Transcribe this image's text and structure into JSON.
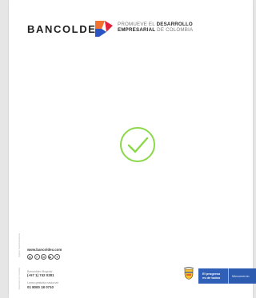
{
  "header": {
    "brand": "BANCOLDEX",
    "tagline_line1_prefix": "PROMUEVE EL",
    "tagline_line1_bold": "DESARROLLO",
    "tagline_line2_bold": "EMPRESARIAL",
    "tagline_line2_suffix": "DE COLOMBIA",
    "colors": {
      "orange": "#f2712e",
      "red": "#e4203c",
      "blue": "#2a54c4",
      "check": "#8bd84a"
    }
  },
  "center": {
    "icon": "checkmark-circle-icon"
  },
  "footer": {
    "website": "www.bancoldex.com",
    "socials": [
      "instagram-icon",
      "facebook-icon",
      "linkedin-icon",
      "youtube-icon",
      "twitter-icon"
    ],
    "social_glyphs": [
      "◎",
      "f",
      "in",
      "▶",
      "♥"
    ],
    "contact1_label": "Bancóldex Bogotá:",
    "contact1_value": "(+57 1)  742 0281",
    "contact2_label": "Línea gratuita nacional:",
    "contact2_value": "01 8000 18 0710",
    "gov_line1": "El progreso",
    "gov_line2": "es de todos",
    "ministry": "Mincomercio",
    "legal_vertical": [
      "Vigilado Superintendencia",
      "Financiera de Colombia"
    ]
  }
}
